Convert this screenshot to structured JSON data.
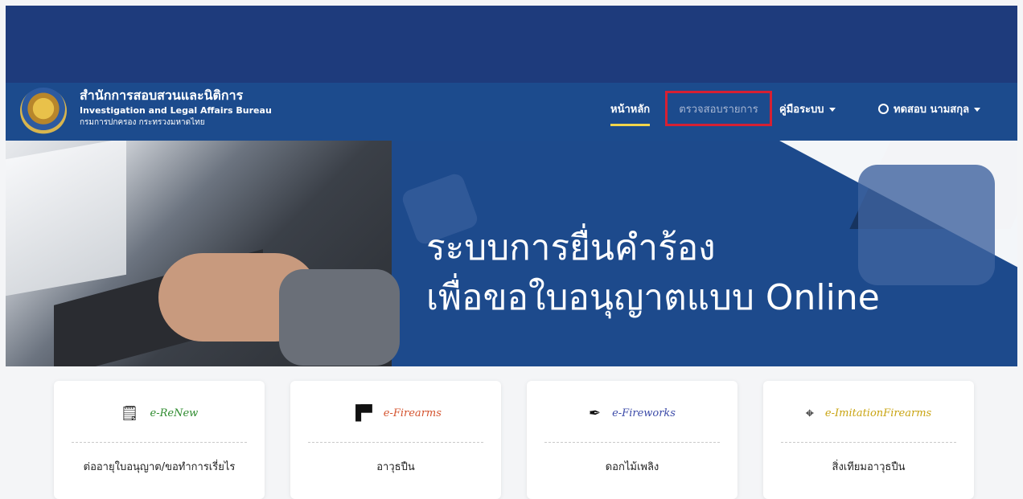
{
  "brand": {
    "title_th": "สำนักการสอบสวนและนิติการ",
    "title_en": "Investigation and Legal Affairs Bureau",
    "subtitle_th": "กรมการปกครอง กระทรวงมหาดไทย"
  },
  "nav": {
    "home": "หน้าหลัก",
    "check": "ตรวจสอบรายการ",
    "manual": "คู่มือระบบ",
    "user": "ทดสอบ นามสกุล"
  },
  "hero": {
    "line1": "ระบบการยื่นคำร้อง",
    "line2": "เพื่อขอใบอนุญาตแบบ Online"
  },
  "cards": [
    {
      "title": "e-ReNew",
      "text": "ต่ออายุใบอนุญาต/ขอทำการเรี่ยไร",
      "icon": "document-check-icon",
      "color": "#2e8b2e"
    },
    {
      "title": "e-Firearms",
      "text": "อาวุธปืน",
      "icon": "gun-icon",
      "color": "#d4532e"
    },
    {
      "title": "e-Fireworks",
      "text": "ดอกไม้เพลิง",
      "icon": "firework-icon",
      "color": "#3b4aa8"
    },
    {
      "title": "e-ImitationFirearms",
      "text": "สิ่งเทียมอาวุธปืน",
      "icon": "target-icon",
      "color": "#c9a411"
    }
  ],
  "colors": {
    "navbar": "#1c4b8d",
    "topband": "#1e3b7c",
    "active_underline": "#f1d54b",
    "highlight_box": "#d62032"
  }
}
